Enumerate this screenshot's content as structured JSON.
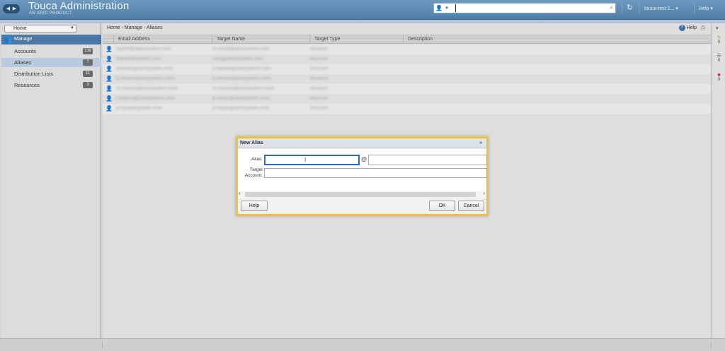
{
  "header": {
    "title": "Touca Administration",
    "subtitle": "AN ARIS PRODUCT",
    "search_value": "",
    "user": "touca-test 2...",
    "help_label": "Help"
  },
  "sidebar": {
    "home_select": "Home",
    "section_label": "Manage",
    "items": [
      {
        "label": "Accounts",
        "badge": "138"
      },
      {
        "label": "Aliases",
        "badge": "7"
      },
      {
        "label": "Distribution Lists",
        "badge": "11"
      },
      {
        "label": "Resources",
        "badge": "3"
      }
    ]
  },
  "main": {
    "breadcrumb": "Home - Manage - Aliases",
    "help_label": "Help",
    "columns": [
      "Email Address",
      "Target Name",
      "Target Type",
      "Description"
    ],
    "rows": [
      {
        "email": "bgohil@aliassystem.com",
        "target": "m.suruti@arissystem.com",
        "type": "Account"
      },
      {
        "email": "hdemkalinskem.com",
        "target": "muagolarissystem.com",
        "type": "Account"
      },
      {
        "email": "bzshefu@arissystem.com",
        "target": "k.kanhar@arissystem.com",
        "type": "Account"
      },
      {
        "email": "b.sharifu@arissystem.com",
        "target": "k.kanhar@arissystem.com",
        "type": "Account"
      },
      {
        "email": "m.sharma@arissystem.com",
        "target": "m.sharma@arissystem.com",
        "type": "Account"
      },
      {
        "email": "r.sharma@arissystem.com",
        "target": "p.kayan@arissystem.com",
        "type": "Account"
      },
      {
        "email": "p.k@arissystem.com",
        "target": "p.kayan@arissystem.com",
        "type": "Account"
      }
    ]
  },
  "rail": {
    "counts": [
      "0",
      "0",
      "0"
    ]
  },
  "dialog": {
    "title": "New Alias",
    "alias_label": "Alias:",
    "at_sign": "@",
    "target_label_line1": "Target",
    "target_label_line2": "Account:",
    "alias_value": "",
    "domain_value": "",
    "target_value": "",
    "help_button": "Help",
    "ok_button": "OK",
    "cancel_button": "Cancel"
  }
}
